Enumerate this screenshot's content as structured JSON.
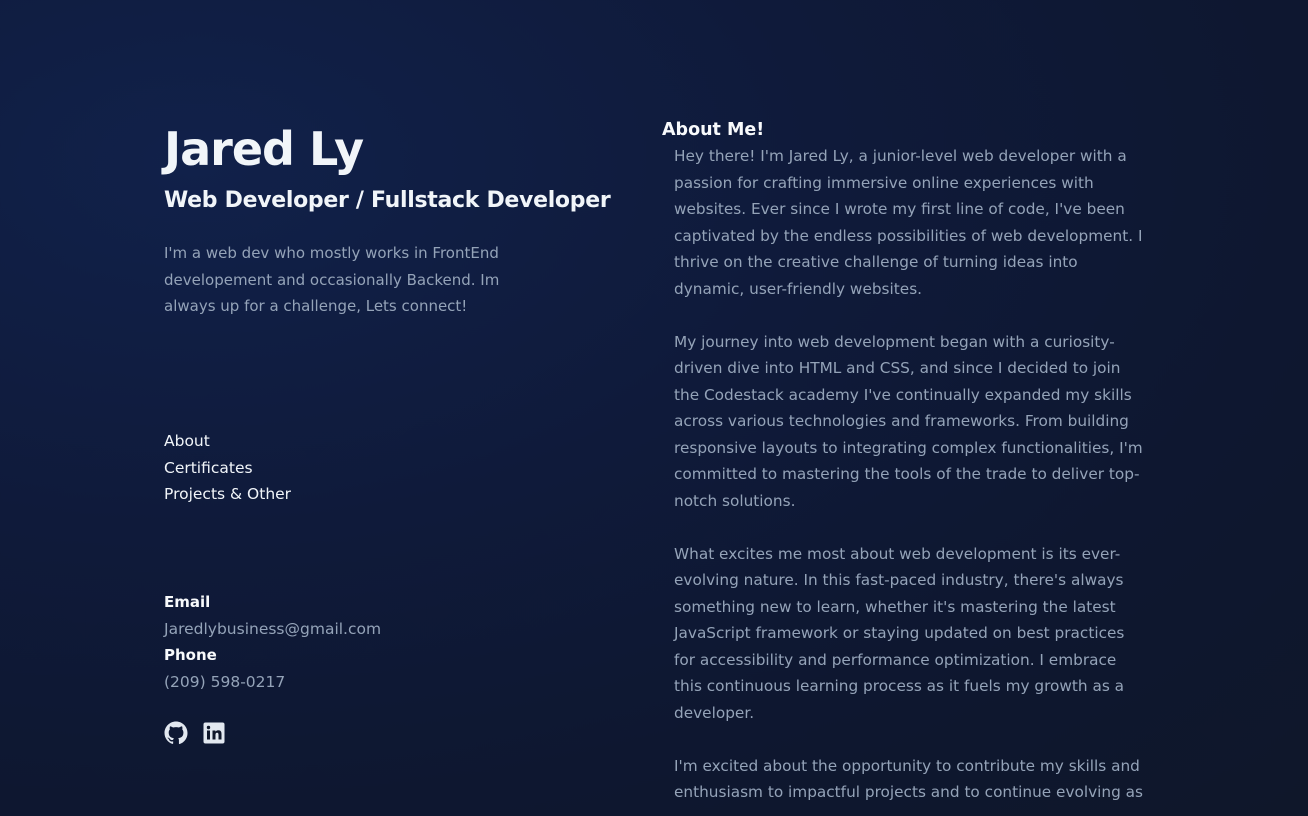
{
  "profile": {
    "name": "Jared Ly",
    "role": "Web Developer / Fullstack Developer",
    "tagline": "I'm a web dev who mostly works in FrontEnd developement and occasionally Backend. Im always up for a challenge, Lets connect!"
  },
  "nav": {
    "items": [
      {
        "label": "About"
      },
      {
        "label": "Certificates"
      },
      {
        "label": "Projects & Other"
      }
    ]
  },
  "contact": {
    "email_label": "Email",
    "email": "Jaredlybusiness@gmail.com",
    "phone_label": "Phone",
    "phone": "(209) 598-0217"
  },
  "socials": [
    {
      "icon": "github-icon"
    },
    {
      "icon": "linkedin-icon"
    }
  ],
  "about": {
    "title": "About Me!",
    "paragraphs": [
      "Hey there! I'm Jared Ly, a junior-level web developer with a passion for crafting immersive online experiences with websites. Ever since I wrote my first line of code, I've been captivated by the endless possibilities of web development. I thrive on the creative challenge of turning ideas into dynamic, user-friendly websites.",
      "My journey into web development began with a curiosity-driven dive into HTML and CSS, and since I decided to join the Codestack academy I've continually expanded my skills across various technologies and frameworks. From building responsive layouts to integrating complex functionalities, I'm committed to mastering the tools of the trade to deliver top-notch solutions.",
      "What excites me most about web development is its ever-evolving nature. In this fast-paced industry, there's always something new to learn, whether it's mastering the latest JavaScript framework or staying updated on best practices for accessibility and performance optimization. I embrace this continuous learning process as it fuels my growth as a developer.",
      "I'm excited about the opportunity to contribute my skills and enthusiasm to impactful projects and to continue evolving as"
    ]
  },
  "colors": {
    "background": "#0f172a",
    "heading": "#f1f5f9",
    "muted": "#94a3b8"
  }
}
